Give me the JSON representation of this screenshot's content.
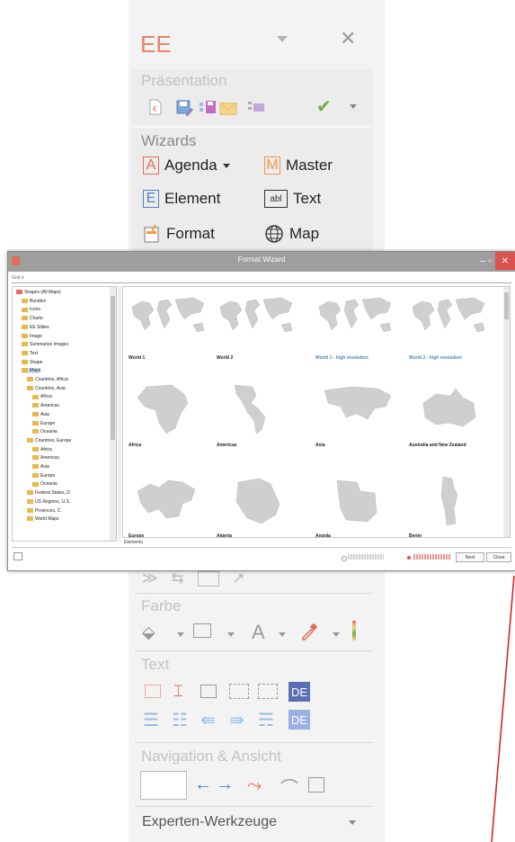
{
  "pane": {
    "title": "EE",
    "presentation_label": "Präsentation",
    "wizards_label": "Wizards",
    "wizards": {
      "agenda": "Agenda",
      "master": "Master",
      "element": "Element",
      "text": "Text",
      "format": "Format",
      "map": "Map",
      "agenda_icon": "A",
      "master_icon": "M",
      "element_icon": "E",
      "text_icon": "abl"
    },
    "farbe_label": "Farbe",
    "text_label": "Text",
    "de_label": "DE",
    "nav_label": "Navigation & Ansicht",
    "experten_label": "Experten-Werkzeuge",
    "colors": {
      "accent_red": "#e36c5b",
      "accent_blue": "#4f81bd",
      "accent_orange": "#f79646",
      "accent_green": "#70ad47",
      "de_blue": "#5b6fb5"
    }
  },
  "dialog": {
    "title": "Format Wizard",
    "tree": [
      "Shapes (All Maps)",
      "Bundles",
      "Icons",
      "Charts",
      "EE Slides",
      "Image",
      "Summarize Images",
      "Text",
      "Shape",
      "Maps",
      "Countries, Africa",
      "Countries, Asia",
      "Africa",
      "Americas",
      "Asia",
      "Europe",
      "Oceania",
      "Countries, Europe",
      "Africa",
      "Americas",
      "Asia",
      "Europe",
      "Oceania",
      "Federal States, D",
      "US Regions, U.S.",
      "Provinces, C.",
      "World Maps"
    ],
    "maps": [
      "World 1",
      "World 2",
      "World 1 - high resolution",
      "World 2 - high resolution",
      "Africa",
      "Americas",
      "Asia",
      "Australia and New Zealand",
      "Europe",
      "Algeria",
      "Angola",
      "Benin"
    ],
    "status_left": "Elements",
    "btn_next": "Next",
    "btn_close": "Close"
  }
}
